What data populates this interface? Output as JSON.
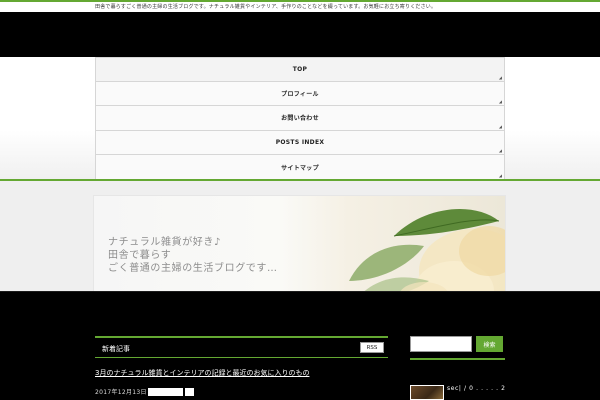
{
  "site": {
    "description": "田舎で暮らすごく普通の主婦の生活ブログです。ナチュラル雑貨やインテリア、手作りのことなどを綴っています。お気軽にお立ち寄りください。"
  },
  "nav": {
    "items": [
      {
        "label": "TOP"
      },
      {
        "label": "プロフィール"
      },
      {
        "label": "お問い合わせ"
      },
      {
        "label": "POSTS INDEX"
      },
      {
        "label": "サイトマップ"
      }
    ]
  },
  "banner": {
    "lines": [
      "ナチュラル雑貨が好き♪",
      "田舎で暮らす",
      "ごく普通の主婦の生活ブログです…"
    ]
  },
  "content": {
    "section_title": "新着記事",
    "rss_label": "RSS",
    "post_title": "3月のナチュラル雑貨とインテリアの記録と最近のお気に入りのもの",
    "post_date": "2017年12月13日"
  },
  "sidebar": {
    "search_placeholder": "",
    "search_button": "検索",
    "profile_text": "sec| / 0 . . . . . 2"
  },
  "colors": {
    "accent": "#64a832",
    "header_bg": "#000000",
    "main_bg": "#000000"
  }
}
